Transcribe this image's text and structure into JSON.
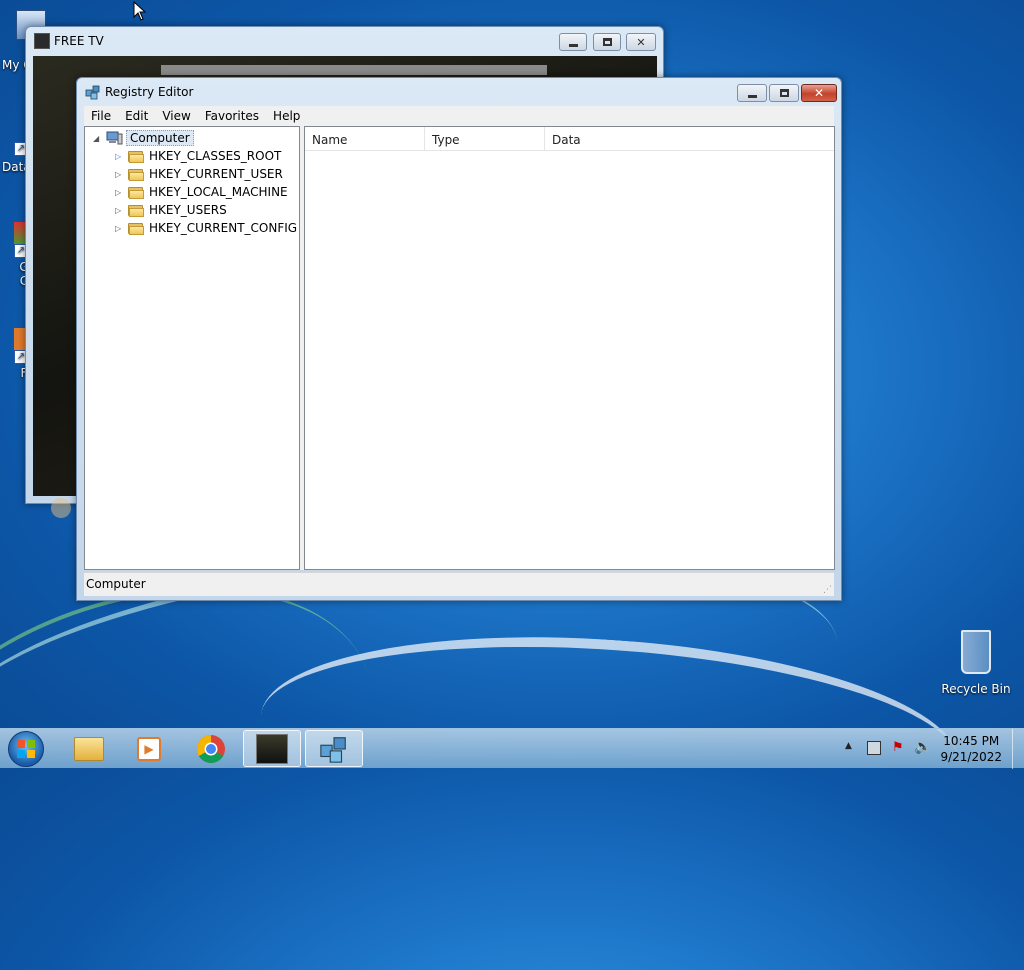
{
  "desktop": {
    "icons": [
      {
        "label": "My C"
      },
      {
        "label": "Data"
      },
      {
        "label": "G"
      },
      {
        "label": "C"
      },
      {
        "label": "F"
      }
    ],
    "recycle_bin": "Recycle Bin"
  },
  "free_tv": {
    "title": "FREE TV"
  },
  "registry": {
    "title": "Registry Editor",
    "menu": [
      "File",
      "Edit",
      "View",
      "Favorites",
      "Help"
    ],
    "tree": {
      "root": "Computer",
      "keys": [
        "HKEY_CLASSES_ROOT",
        "HKEY_CURRENT_USER",
        "HKEY_LOCAL_MACHINE",
        "HKEY_USERS",
        "HKEY_CURRENT_CONFIG"
      ]
    },
    "columns": [
      "Name",
      "Type",
      "Data"
    ],
    "status": "Computer"
  },
  "taskbar": {
    "time": "10:45 PM",
    "date": "9/21/2022"
  },
  "colors": {
    "accent": "#1f79cc",
    "close_button": "#c3432c"
  }
}
